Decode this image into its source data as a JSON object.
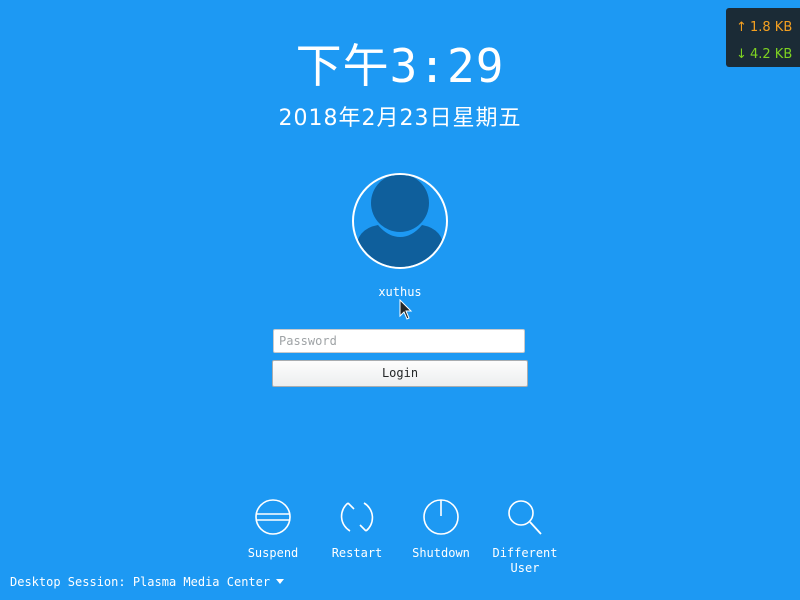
{
  "clock": {
    "prefix": "下午",
    "time": "3:29"
  },
  "date": {
    "text": "2018年2月23日星期五"
  },
  "user": {
    "username": "xuthus",
    "avatar_icon": "user-avatar-icon"
  },
  "login": {
    "password_placeholder": "Password",
    "password_value": "",
    "button_label": "Login"
  },
  "actions": [
    {
      "label": "Suspend",
      "icon": "suspend-icon"
    },
    {
      "label": "Restart",
      "icon": "restart-icon"
    },
    {
      "label": "Shutdown",
      "icon": "shutdown-icon"
    },
    {
      "label": "Different User",
      "icon": "search-user-icon"
    }
  ],
  "session": {
    "label": "Desktop Session: Plasma Media Center"
  },
  "network": {
    "upload": "1.8 KB",
    "download": "4.2 KB"
  },
  "colors": {
    "background": "#1d99f3",
    "avatar": "#0f5f9c",
    "upload": "#f4a020",
    "download": "#7ed321"
  }
}
